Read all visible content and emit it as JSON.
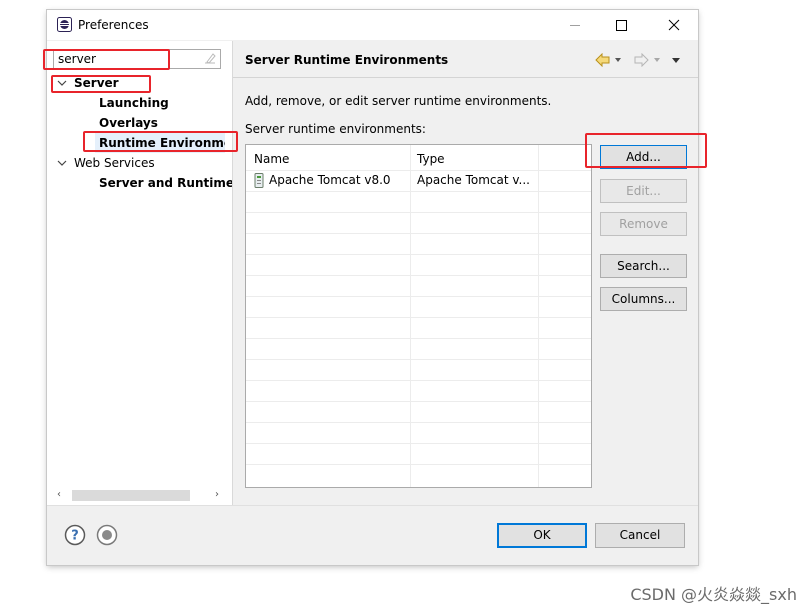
{
  "window": {
    "title": "Preferences"
  },
  "filter": {
    "value": "server"
  },
  "tree": {
    "items": [
      {
        "label": "Server",
        "expanded": true,
        "bold": true
      },
      {
        "label": "Launching",
        "bold": true
      },
      {
        "label": "Overlays",
        "bold": true
      },
      {
        "label": "Runtime Environme",
        "bold": true,
        "selected": true
      },
      {
        "label": "Web Services",
        "expanded": true,
        "bold": false
      },
      {
        "label": "Server and Runtime",
        "bold": true
      }
    ]
  },
  "page": {
    "title": "Server Runtime Environments",
    "description": "Add, remove, or edit server runtime environments.",
    "table_label": "Server runtime environments:"
  },
  "table": {
    "headers": [
      "Name",
      "Type"
    ],
    "rows": [
      {
        "name": "Apache Tomcat v8.0",
        "type": "Apache Tomcat v..."
      }
    ]
  },
  "buttons": {
    "add": "Add...",
    "edit": "Edit...",
    "remove": "Remove",
    "search": "Search...",
    "columns": "Columns..."
  },
  "footer": {
    "ok": "OK",
    "cancel": "Cancel"
  },
  "watermark": "CSDN @火炎焱燚_sxh",
  "colors": {
    "highlight": "#e8242b",
    "focus": "#0078d7",
    "selection": "#e5f0fb"
  }
}
